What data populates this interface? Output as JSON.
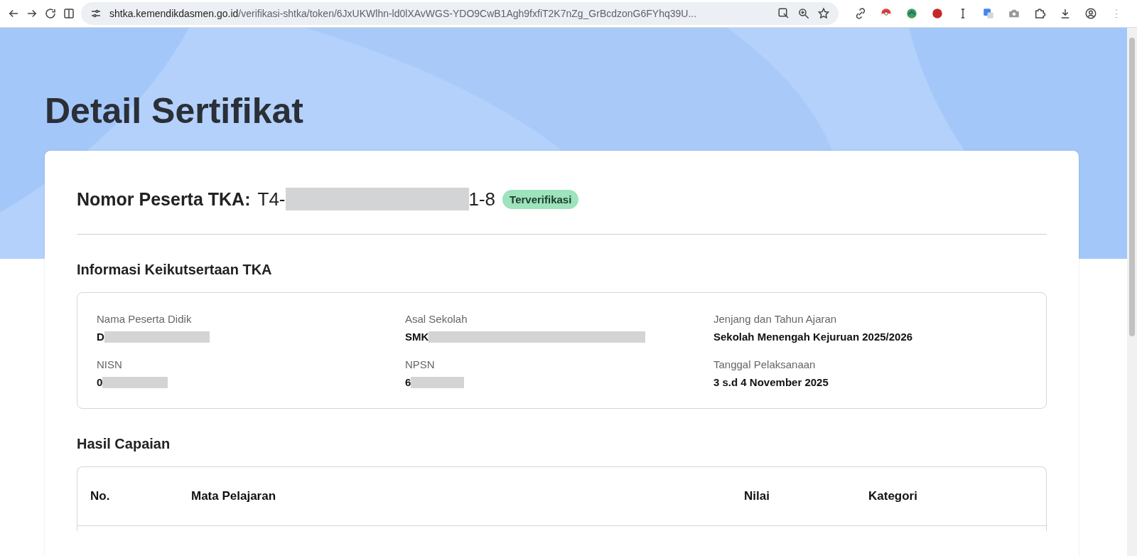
{
  "browser": {
    "url_host": "shtka.kemendikdasmen.go.id",
    "url_path": "/verifikasi-shtka/token/6JxUKWlhn-ld0lXAvWGS-YDO9CwB1Agh9fxfiT2K7nZg_GrBcdzonG6FYhq39U..."
  },
  "page": {
    "title": "Detail Sertifikat"
  },
  "participant": {
    "label": "Nomor Peserta TKA:",
    "number_start": "T4-",
    "number_end": "1-8",
    "status": "Terverifikasi",
    "verified": true
  },
  "info": {
    "heading": "Informasi Keikutsertaan TKA",
    "fields": [
      {
        "label": "Nama Peserta Didik",
        "value": "D",
        "redacted": true
      },
      {
        "label": "Asal Sekolah",
        "value": "SMK",
        "redacted": true
      },
      {
        "label": "Jenjang dan Tahun Ajaran",
        "value": "Sekolah Menengah Kejuruan 2025/2026",
        "redacted": false
      },
      {
        "label": "NISN",
        "value": "0",
        "redacted": true
      },
      {
        "label": "NPSN",
        "value": "6",
        "redacted": true
      },
      {
        "label": "Tanggal Pelaksanaan",
        "value": "3 s.d 4 November 2025",
        "redacted": false
      }
    ]
  },
  "results": {
    "heading": "Hasil Capaian",
    "columns": [
      "No.",
      "Mata Pelajaran",
      "Nilai",
      "Kategori"
    ]
  }
}
